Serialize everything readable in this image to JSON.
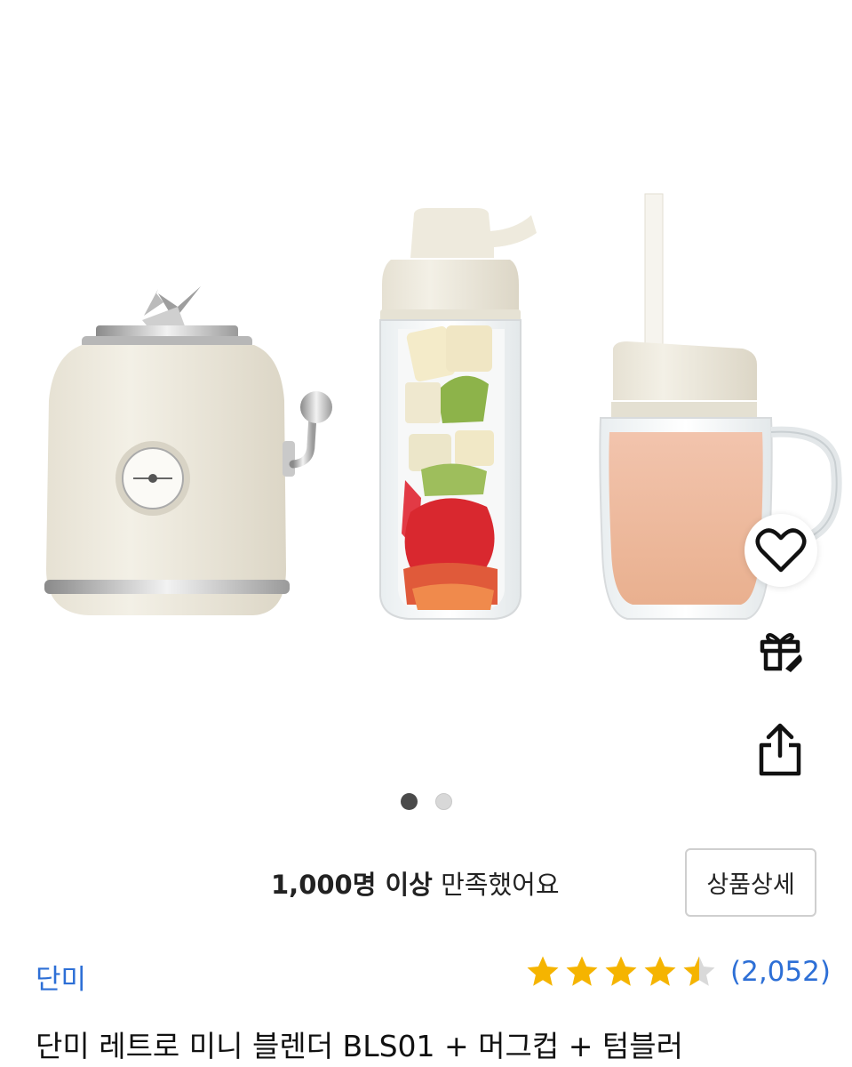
{
  "hero": {
    "slide_index": 1,
    "slide_total": 2,
    "accent_cream": "#ece8dc",
    "accent_steel": "#b8b8b8"
  },
  "actions": {
    "wishlist_icon": "heart-icon",
    "gift_icon": "gift-icon",
    "share_icon": "share-icon"
  },
  "summary": {
    "satisfied_strong": "1,000명 이상",
    "satisfied_rest": " 만족했어요",
    "detail_button": "상품상세"
  },
  "product": {
    "brand": "단미",
    "rating": 4.5,
    "rating_max": 5,
    "review_count": "(2,052)",
    "title": "단미 레트로 미니 블렌더 BLS01 + 머그컵 + 텀블러",
    "brand_color": "#2d6fd6",
    "star_color": "#f5b400"
  }
}
